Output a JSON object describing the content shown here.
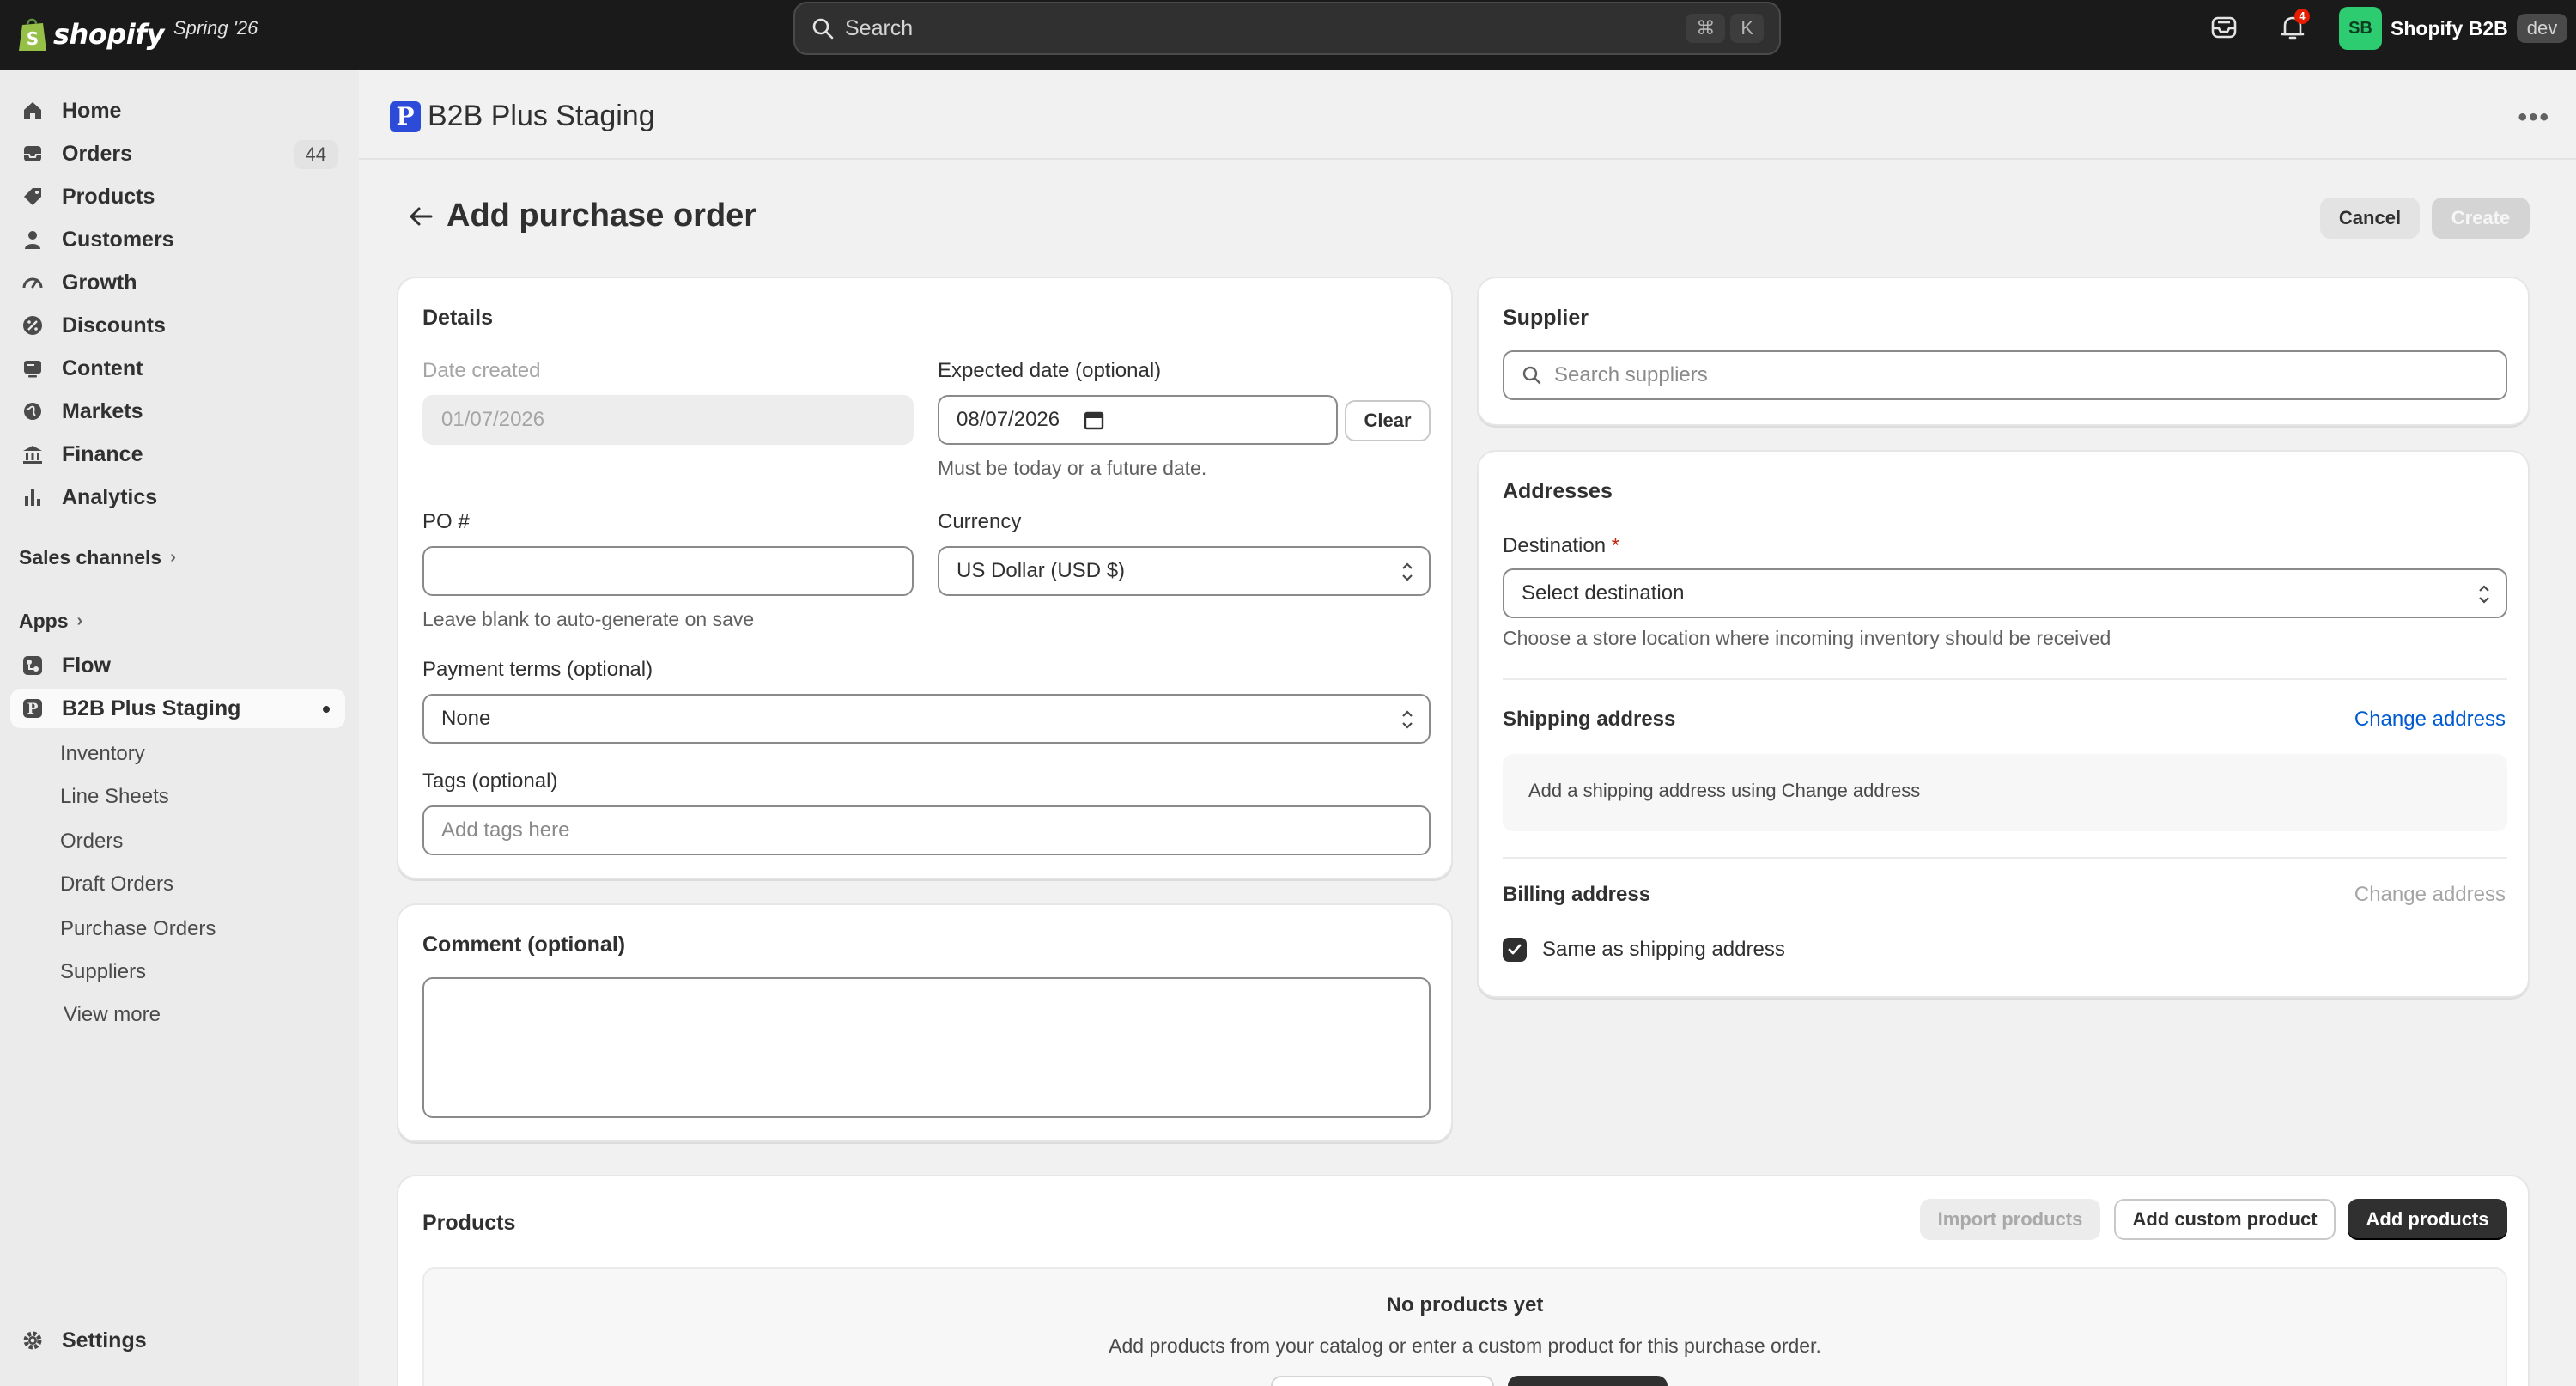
{
  "topbar": {
    "brand": "shopify",
    "edition": "Spring '26",
    "search_placeholder": "Search",
    "shortcut_cmd": "⌘",
    "shortcut_key": "K",
    "notification_count": "4",
    "account_initials": "SB",
    "account_name": "Shopify B2B",
    "env_tag": "dev"
  },
  "sidebar": {
    "items": [
      {
        "label": "Home",
        "icon": "home-icon"
      },
      {
        "label": "Orders",
        "icon": "inbox-icon",
        "badge": "44"
      },
      {
        "label": "Products",
        "icon": "tag-icon"
      },
      {
        "label": "Customers",
        "icon": "person-icon"
      },
      {
        "label": "Growth",
        "icon": "gauge-icon"
      },
      {
        "label": "Discounts",
        "icon": "discount-icon"
      },
      {
        "label": "Content",
        "icon": "content-icon"
      },
      {
        "label": "Markets",
        "icon": "globe-icon"
      },
      {
        "label": "Finance",
        "icon": "bank-icon"
      },
      {
        "label": "Analytics",
        "icon": "bar-chart-icon"
      }
    ],
    "sales_channels": "Sales channels",
    "apps": "Apps",
    "app_items": [
      {
        "label": "Flow",
        "icon": "flow-icon"
      },
      {
        "label": "B2B Plus Staging",
        "icon": "app-p-icon"
      }
    ],
    "sub_items": [
      "Inventory",
      "Line Sheets",
      "Orders",
      "Draft Orders",
      "Purchase Orders",
      "Suppliers",
      "View more"
    ],
    "settings": "Settings"
  },
  "header": {
    "app_name": "B2B Plus Staging",
    "app_logo_letter": "P"
  },
  "page": {
    "title": "Add purchase order",
    "cancel": "Cancel",
    "create": "Create"
  },
  "details": {
    "title": "Details",
    "date_created_label": "Date created",
    "date_created_value": "01/07/2026",
    "expected_label": "Expected date (optional)",
    "expected_value": "08/07/2026",
    "clear": "Clear",
    "expected_help": "Must be today or a future date.",
    "po_label": "PO #",
    "po_value": "",
    "po_help": "Leave blank to auto-generate on save",
    "currency_label": "Currency",
    "currency_value": "US Dollar (USD $)",
    "payment_label": "Payment terms (optional)",
    "payment_value": "None",
    "tags_label": "Tags (optional)",
    "tags_placeholder": "Add tags here"
  },
  "comment": {
    "title": "Comment (optional)",
    "value": ""
  },
  "supplier": {
    "title": "Supplier",
    "search_placeholder": "Search suppliers"
  },
  "addresses": {
    "title": "Addresses",
    "destination_label": "Destination",
    "required_mark": "*",
    "destination_value": "Select destination",
    "destination_help": "Choose a store location where incoming inventory should be received",
    "shipping_title": "Shipping address",
    "change_address": "Change address",
    "shipping_empty": "Add a shipping address using Change address",
    "billing_title": "Billing address",
    "same_as_shipping": "Same as shipping address",
    "same_as_shipping_checked": true
  },
  "products": {
    "title": "Products",
    "import": "Import products",
    "add_custom": "Add custom product",
    "add": "Add products",
    "empty_title": "No products yet",
    "empty_text": "Add products from your catalog or enter a custom product for this purchase order."
  },
  "colors": {
    "topbar": "#1a1a1a",
    "link": "#005bd3",
    "primary_button": "#303030",
    "avatar": "#2ecc71",
    "notification": "#e51c00",
    "app_logo": "#2c4bd9"
  }
}
